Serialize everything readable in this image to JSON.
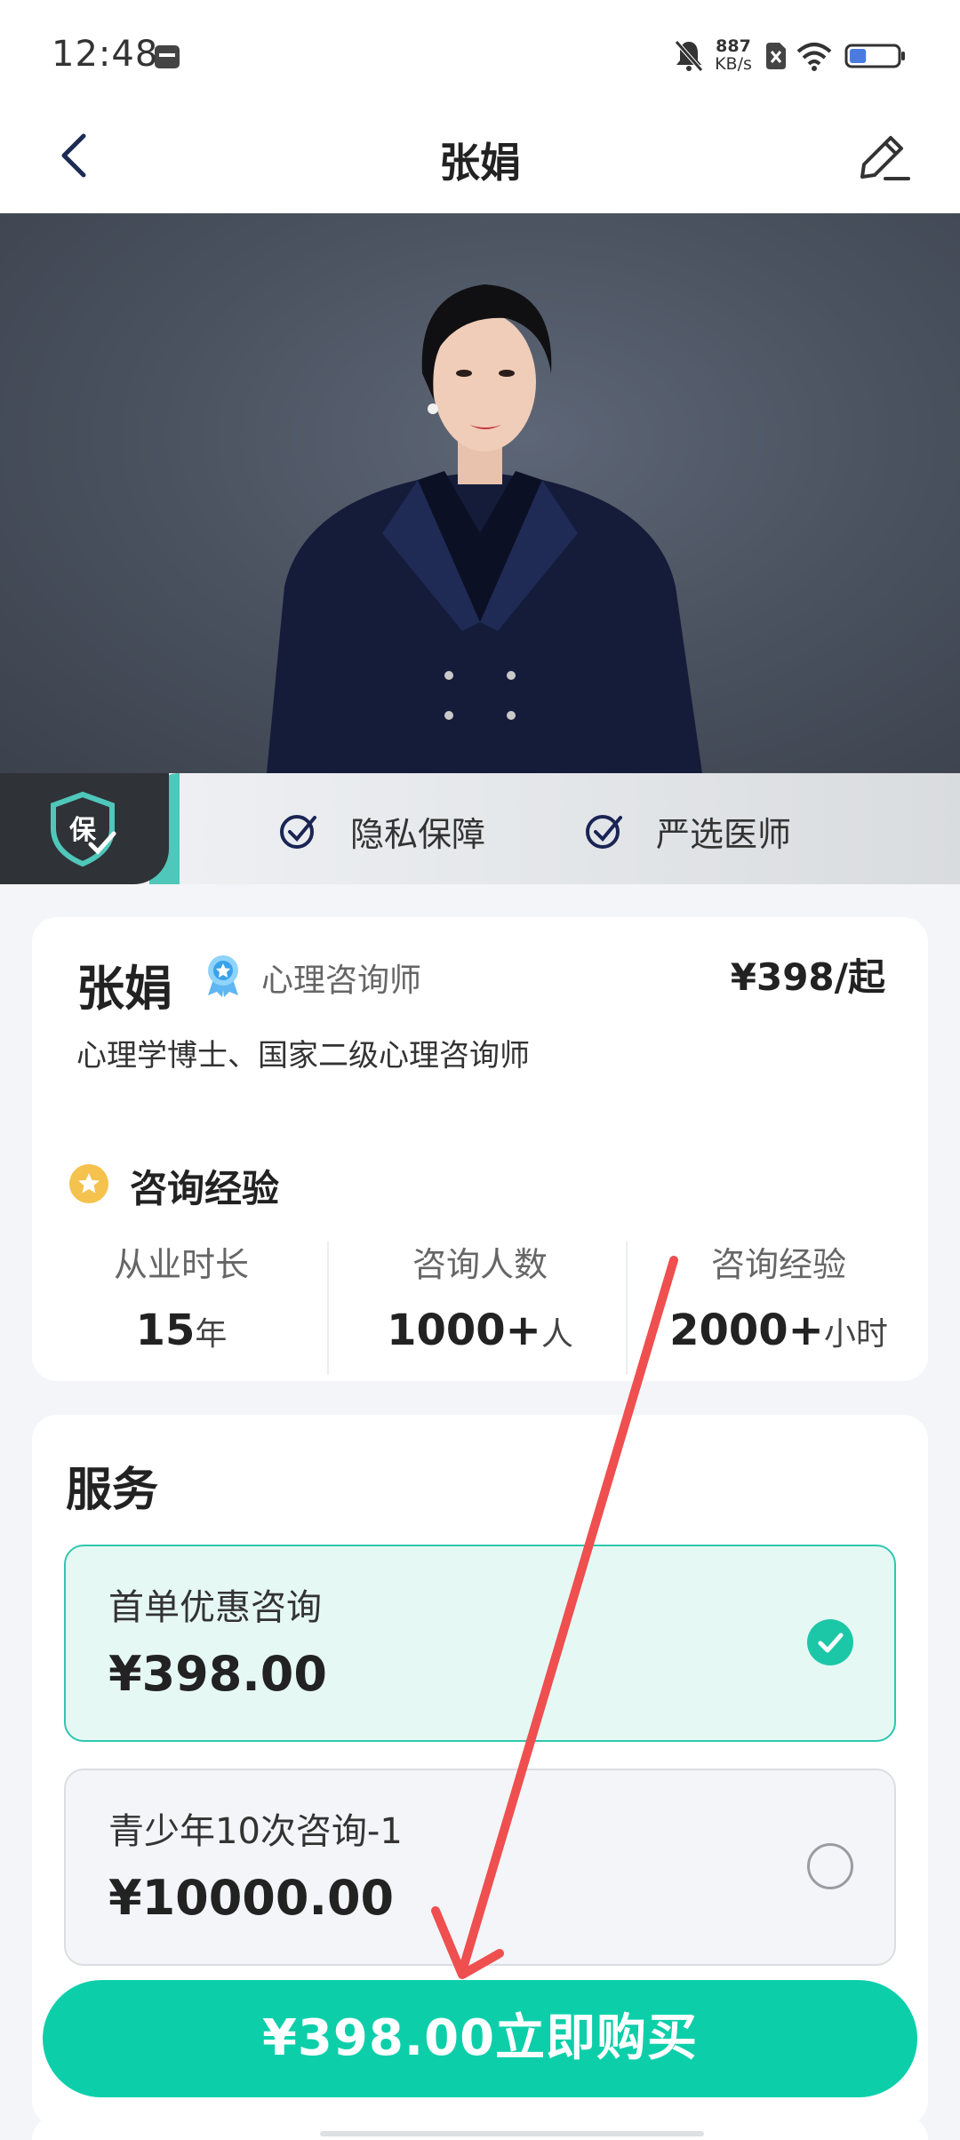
{
  "status_bar": {
    "time": "12:48",
    "net_speed_value": "887",
    "net_speed_unit": "KB/s",
    "battery_level": 0.35,
    "icons": [
      "calendar-icon",
      "mute-icon",
      "sim-off-icon",
      "wifi-icon",
      "battery-icon"
    ]
  },
  "nav": {
    "title": "张娟",
    "back_icon": "chevron-left-icon",
    "edit_icon": "pencil-icon"
  },
  "hero": {
    "image": "portrait photo of counselor"
  },
  "badges": {
    "shield_text": "保",
    "items": [
      {
        "label": "隐私保障"
      },
      {
        "label": "严选医师"
      }
    ]
  },
  "profile": {
    "name": "张娟",
    "title": "心理咨询师",
    "price_from": "¥398/起",
    "qualification": "心理学博士、国家二级心理咨询师",
    "experience_heading": "咨询经验",
    "stats": [
      {
        "label": "从业时长",
        "value": "15",
        "unit": "年"
      },
      {
        "label": "咨询人数",
        "value": "1000+",
        "unit": "人"
      },
      {
        "label": "咨询经验",
        "value": "2000+",
        "unit": "小时"
      }
    ]
  },
  "services": {
    "title": "服务",
    "options": [
      {
        "name": "首单优惠咨询",
        "price": "¥398.00",
        "selected": true
      },
      {
        "name": "青少年10次咨询-1",
        "price": "¥10000.00",
        "selected": false
      }
    ]
  },
  "buy_button": {
    "label": "¥398.00立即购买"
  },
  "colors": {
    "accent": "#0ccfaa",
    "selected_bg": "#e6f8f4",
    "annotation": "#ef4f4f"
  }
}
